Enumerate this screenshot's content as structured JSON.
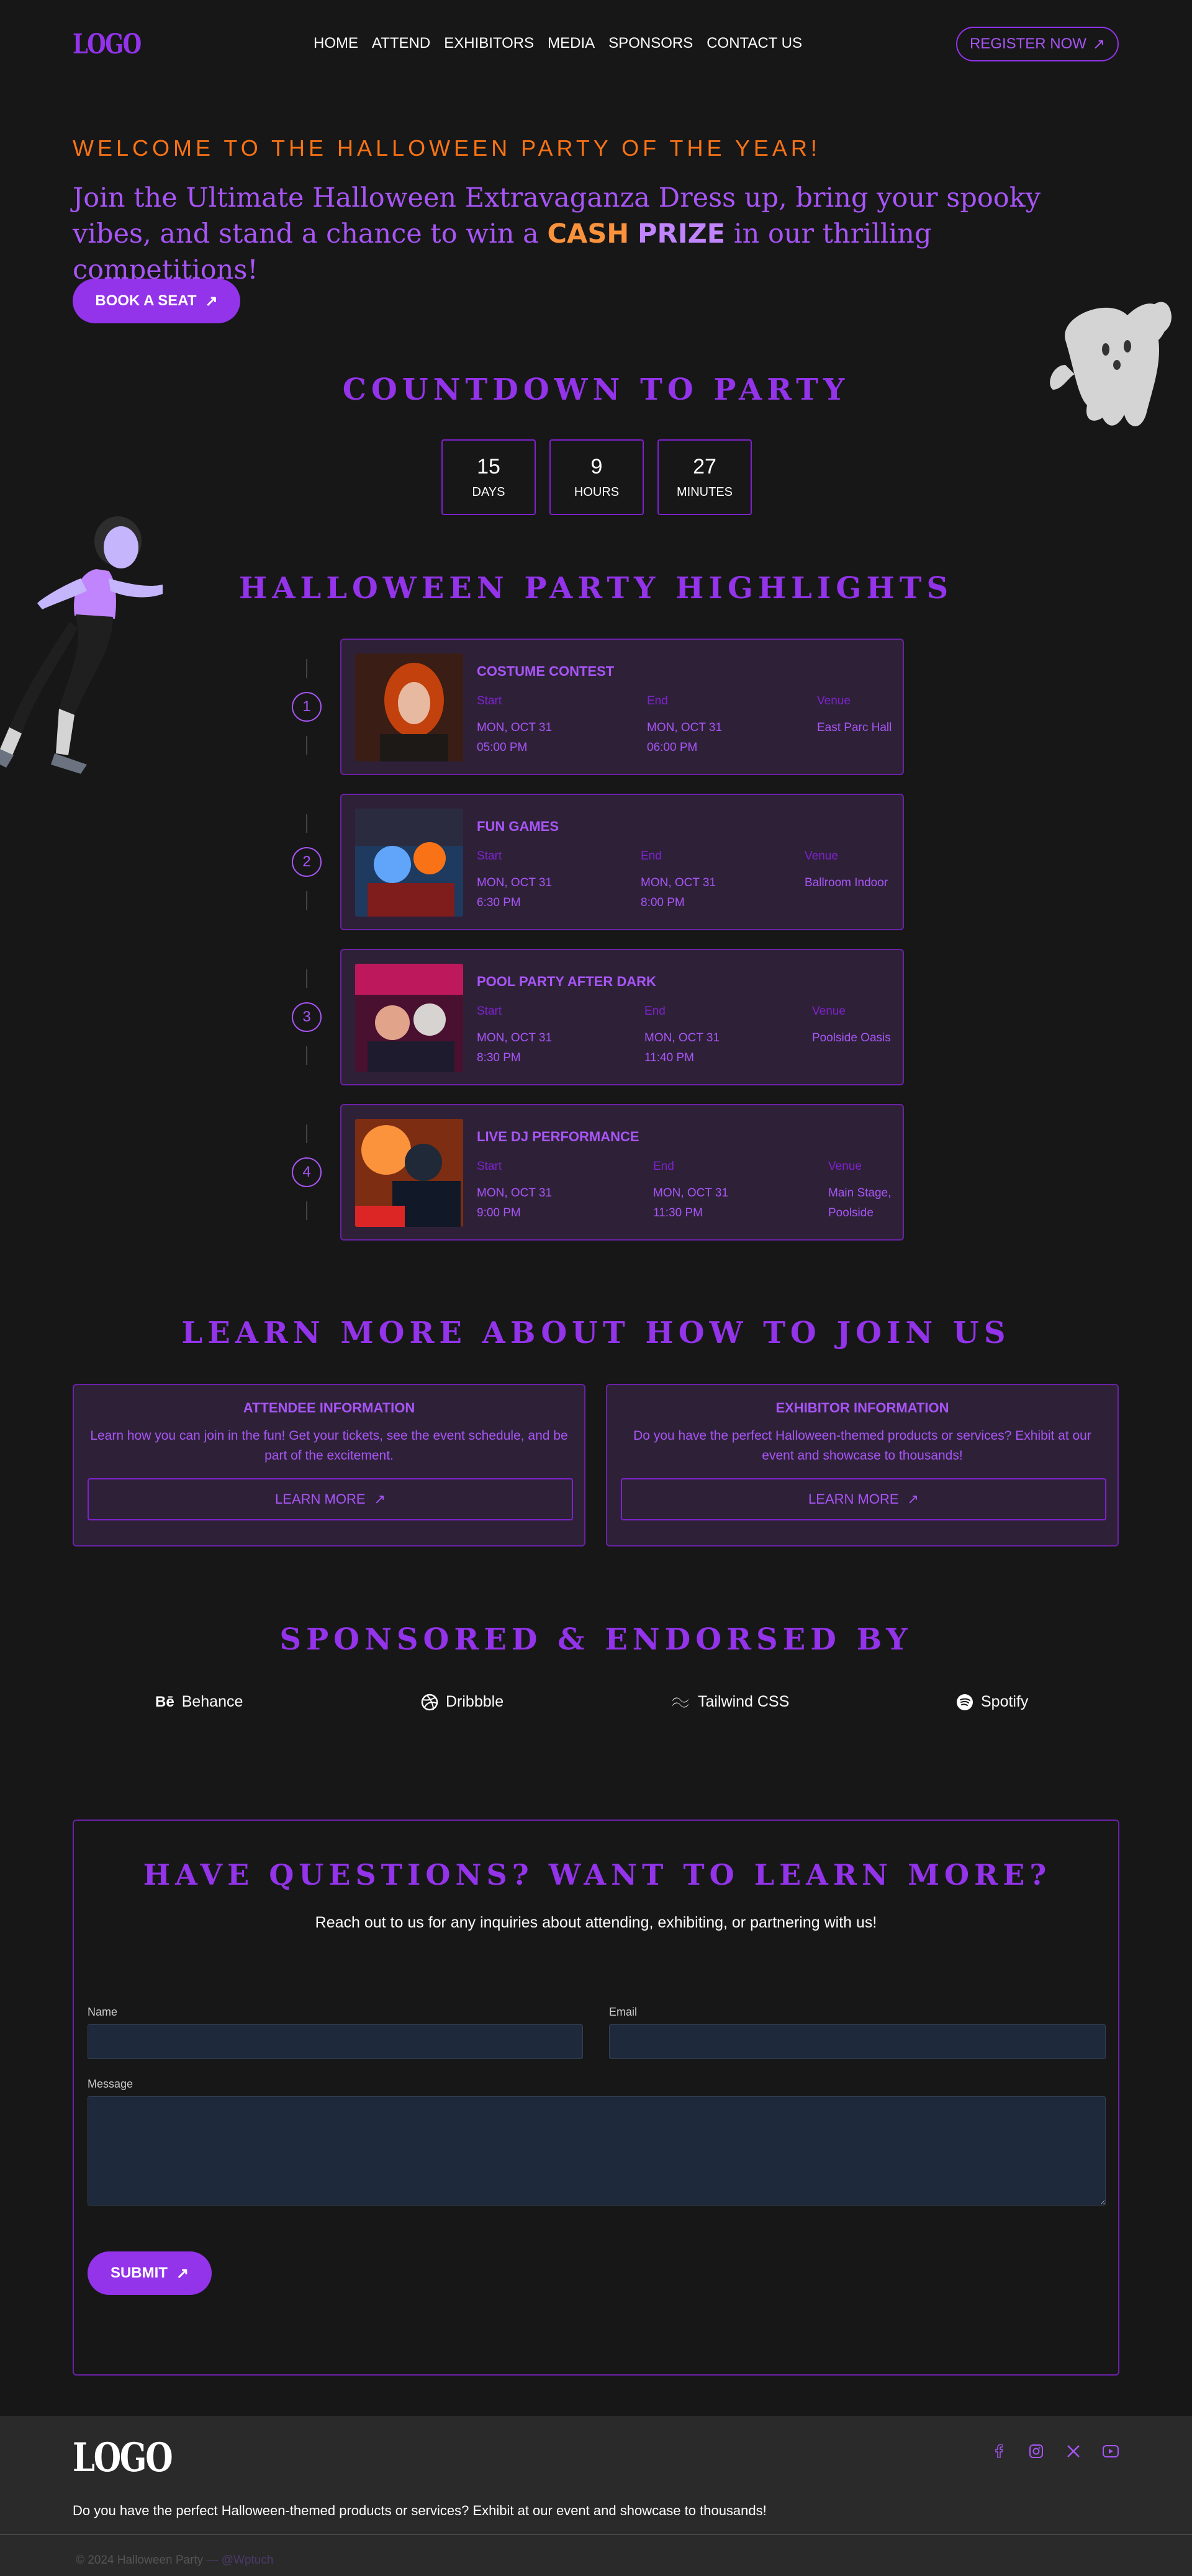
{
  "header": {
    "logo": "LOGO",
    "nav": [
      "HOME",
      "ATTEND",
      "EXHIBITORS",
      "MEDIA",
      "SPONSORS",
      "CONTACT US"
    ],
    "register": "REGISTER NOW"
  },
  "hero": {
    "welcome": "WELCOME TO THE HALLOWEEN PARTY OF THE YEAR!",
    "text_before": "Join the Ultimate Halloween Extravaganza Dress up, bring your spooky vibes, and stand a chance to win a",
    "cash": "CASH",
    "prize": "PRIZE",
    "text_after": "in our thrilling competitions!",
    "cta": "BOOK A SEAT"
  },
  "countdown": {
    "title": "COUNTDOWN TO PARTY",
    "items": [
      {
        "value": "15",
        "label": "DAYS"
      },
      {
        "value": "9",
        "label": "HOURS"
      },
      {
        "value": "27",
        "label": "MINUTES"
      }
    ]
  },
  "highlights": {
    "title": "HALLOWEEN PARTY HIGHLIGHTS",
    "start_label": "Start",
    "end_label": "End",
    "venue_label": "Venue",
    "events": [
      {
        "num": "1",
        "title": "COSTUME CONTEST",
        "start_date": "MON, OCT 31",
        "start_time": "05:00 PM",
        "end_date": "MON, OCT 31",
        "end_time": "06:00 PM",
        "venue": "East Parc Hall"
      },
      {
        "num": "2",
        "title": "FUN GAMES",
        "start_date": "MON, OCT 31",
        "start_time": "6:30 PM",
        "end_date": "MON, OCT 31",
        "end_time": "8:00 PM",
        "venue": "Ballroom Indoor"
      },
      {
        "num": "3",
        "title": "POOL PARTY AFTER DARK",
        "start_date": "MON, OCT 31",
        "start_time": "8:30 PM",
        "end_date": "MON, OCT 31",
        "end_time": "11:40 PM",
        "venue": "Poolside Oasis"
      },
      {
        "num": "4",
        "title": "LIVE DJ PERFORMANCE",
        "start_date": "MON, OCT 31",
        "start_time": "9:00 PM",
        "end_date": "MON, OCT 31",
        "end_time": "11:30 PM",
        "venue": "Main Stage, Poolside"
      }
    ]
  },
  "join": {
    "title": "LEARN MORE ABOUT HOW TO JOIN US",
    "attendee_title": "ATTENDEE INFORMATION",
    "attendee_desc": "Learn how you can join in the fun! Get your tickets, see the event schedule, and be part of the excitement.",
    "exhibitor_title": "EXHIBITOR INFORMATION",
    "exhibitor_desc": "Do you have the perfect Halloween-themed products or services? Exhibit at our event and showcase to thousands!",
    "learn_more": "LEARN MORE"
  },
  "sponsors": {
    "title": "SPONSORED & ENDORSED BY",
    "items": [
      {
        "name": "Behance",
        "icon": "behance-icon"
      },
      {
        "name": "Dribbble",
        "icon": "dribbble-icon"
      },
      {
        "name": "Tailwind CSS",
        "icon": "tailwind-icon"
      },
      {
        "name": "Spotify",
        "icon": "spotify-icon"
      }
    ]
  },
  "contact": {
    "title": "HAVE QUESTIONS? WANT TO LEARN MORE?",
    "subtitle": "Reach out to us for any inquiries about attending, exhibiting, or partnering with us!",
    "name_label": "Name",
    "email_label": "Email",
    "message_label": "Message",
    "name_value": "",
    "email_value": "",
    "message_value": "",
    "submit": "SUBMIT"
  },
  "footer": {
    "logo": "LOGO",
    "desc": "Do you have the perfect Halloween-themed products or services? Exhibit at our event and showcase to thousands!",
    "copyright": "© 2024 Halloween Party",
    "brand": "— @Wptuch",
    "social": [
      "facebook-icon",
      "instagram-icon",
      "x-icon",
      "youtube-icon"
    ]
  },
  "colors": {
    "accent": "#9333ea",
    "accent_light": "#a855f7",
    "orange": "#f97316",
    "background": "#171717",
    "card": "#2e2137"
  }
}
